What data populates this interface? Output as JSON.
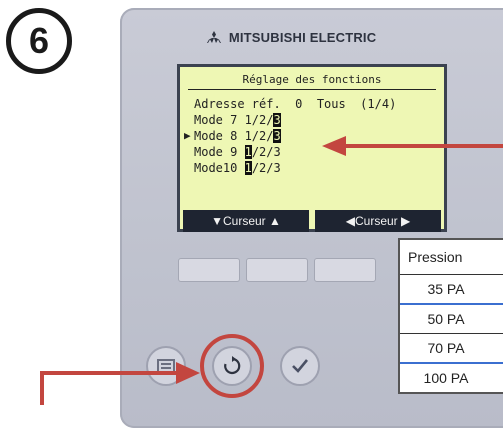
{
  "step": {
    "number": "6"
  },
  "brand": {
    "name": "MITSUBISHI ELECTRIC"
  },
  "lcd": {
    "title": "Réglage des fonctions",
    "rows": [
      {
        "cursor": "",
        "label": "Adresse réf.",
        "value": "0  Tous  (1/4)",
        "highlight": ""
      },
      {
        "cursor": "",
        "label": "Mode 7 1/2/",
        "value": "",
        "highlight": "3"
      },
      {
        "cursor": "▶",
        "label": "Mode 8 1/2/",
        "value": "",
        "highlight": "3"
      },
      {
        "cursor": "",
        "label": "Mode 9 ",
        "value": "/2/3",
        "highlight": "1"
      },
      {
        "cursor": "",
        "label": "Mode10 ",
        "value": "/2/3",
        "highlight": "1"
      }
    ],
    "softkeys": [
      "▼Curseur ▲",
      "◀Curseur ▶"
    ]
  },
  "table": {
    "header": "Pression",
    "rows": [
      "35 PA",
      "50 PA",
      "70 PA",
      "100 PA"
    ]
  },
  "colors": {
    "accent": "#c3463f",
    "lcd_bg": "#eef7b4",
    "remote_body": "#c4c6d2",
    "table_rule": "#3b6fd0"
  },
  "icons": [
    "menu-icon",
    "return-icon",
    "check-icon",
    "mitsubishi-logo-icon"
  ]
}
